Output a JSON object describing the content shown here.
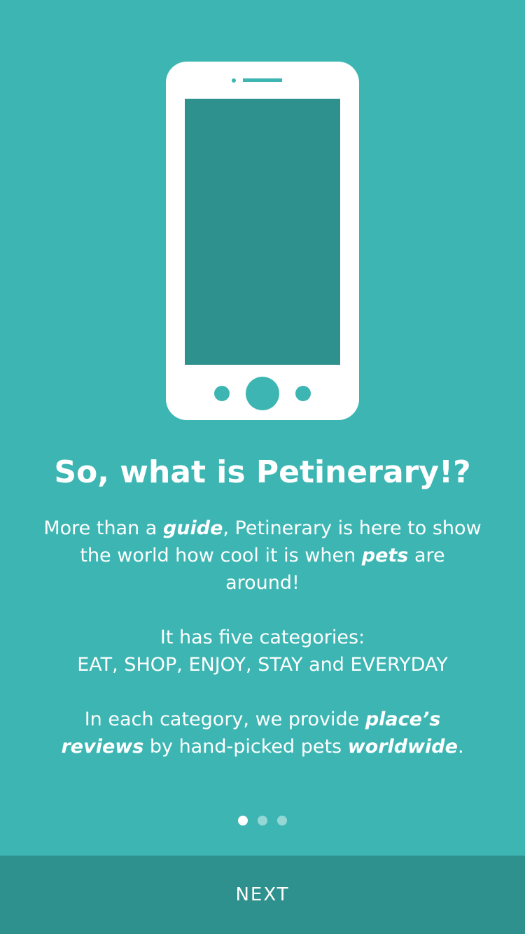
{
  "colors": {
    "background": "#3db6b3",
    "phone_screen": "#2e918e",
    "next_bar": "#2f918d",
    "text": "#ffffff"
  },
  "illustration": {
    "icon": "smartphone-icon"
  },
  "content": {
    "title": "So, what is Petinerary!?",
    "p1": {
      "t1": "More than a ",
      "guide": "guide",
      "t2": ", Petinerary is here to show the world how cool it is when ",
      "pets": "pets",
      "t3": " are around!"
    },
    "p2": {
      "line1": "It has five categories:",
      "line2": "EAT, SHOP, ENJOY, STAY and EVERYDAY"
    },
    "p3": {
      "t1": "In each category, we provide ",
      "places_reviews": "place’s reviews",
      "t2": " by hand-picked pets ",
      "worldwide": "worldwide",
      "t3": "."
    }
  },
  "pager": {
    "count": 3,
    "active_index": 0
  },
  "footer": {
    "next_label": "NEXT"
  }
}
